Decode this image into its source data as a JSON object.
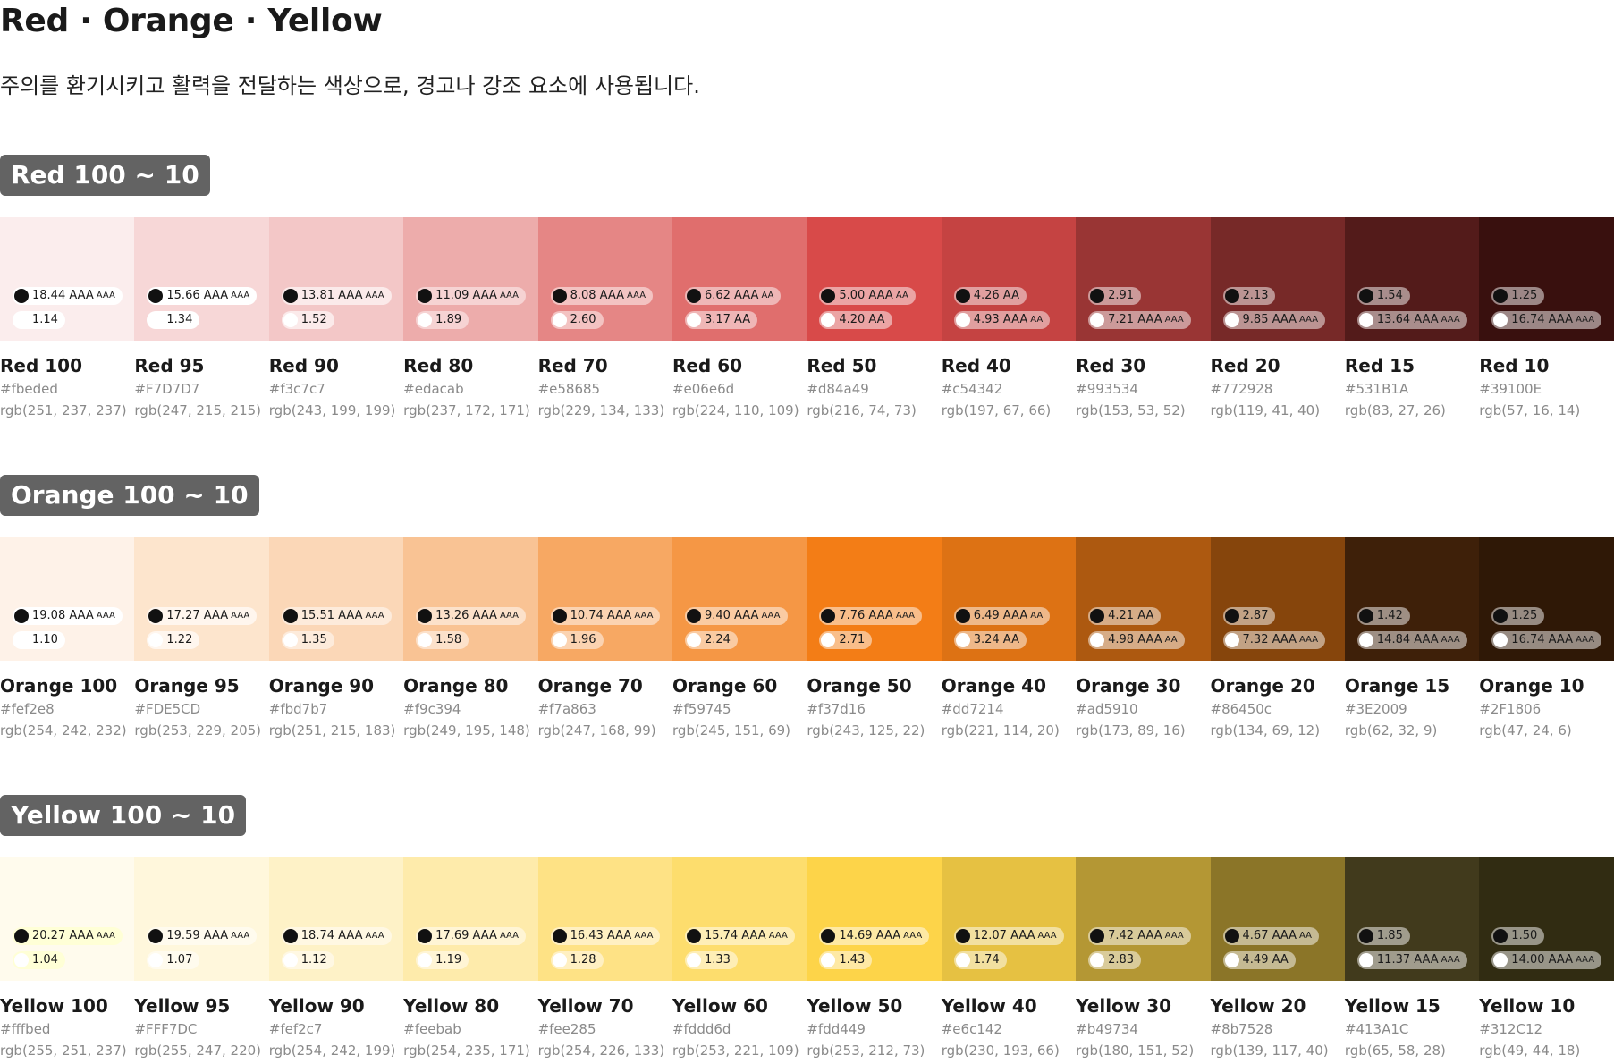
{
  "title": "Red · Orange · Yellow",
  "description": "주의를 환기시키고 활력을 전달하는 색상으로, 경고나 강조 요소에 사용됩니다.",
  "sections": [
    {
      "label": "Red 100 ~ 10",
      "swatches": [
        {
          "name": "Red 100",
          "hex": "#fbeded",
          "rgb": "rgb(251, 237, 237)",
          "black": "18.44 AAA",
          "black_level": "AAA",
          "white": "1.14",
          "white_level": "",
          "pill_dark_bg": "#ffffff",
          "pill_light_bg": "#ffffff",
          "pill_dark_fg": "#1a1a1a",
          "pill_light_fg": "#1a1a1a"
        },
        {
          "name": "Red 95",
          "hex": "#F7D7D7",
          "rgb": "rgb(247, 215, 215)",
          "black": "15.66 AAA",
          "black_level": "AAA",
          "white": "1.34",
          "white_level": "",
          "pill_dark_bg": "#ffffff",
          "pill_light_bg": "#ffffff",
          "pill_dark_fg": "#1a1a1a",
          "pill_light_fg": "#1a1a1a"
        },
        {
          "name": "Red 90",
          "hex": "#f3c7c7",
          "rgb": "rgb(243, 199, 199)",
          "black": "13.81 AAA",
          "black_level": "AAA",
          "white": "1.52",
          "white_level": "",
          "pill_dark_bg": "#fbeaea",
          "pill_light_bg": "#fbeaea",
          "pill_dark_fg": "#1a1a1a",
          "pill_light_fg": "#1a1a1a"
        },
        {
          "name": "Red 80",
          "hex": "#edacab",
          "rgb": "rgb(237, 172, 171)",
          "black": "11.09 AAA",
          "black_level": "AAA",
          "white": "1.89",
          "white_level": "",
          "pill_dark_bg": "#f6d3d3",
          "pill_light_bg": "#f6d3d3",
          "pill_dark_fg": "#1a1a1a",
          "pill_light_fg": "#1a1a1a"
        },
        {
          "name": "Red 70",
          "hex": "#e58685",
          "rgb": "rgb(229, 134, 133)",
          "black": "8.08 AAA",
          "black_level": "AAA",
          "white": "2.60",
          "white_level": "",
          "pill_dark_bg": "#f3c3c2",
          "pill_light_bg": "#f3c3c2",
          "pill_dark_fg": "#1a1a1a",
          "pill_light_fg": "#1a1a1a"
        },
        {
          "name": "Red 60",
          "hex": "#e06e6d",
          "rgb": "rgb(224, 110, 109)",
          "black": "6.62 AAA",
          "black_level": "AA",
          "white": "3.17 AA",
          "white_level": "",
          "pill_dark_bg": "#efb6b6",
          "pill_light_bg": "#efb6b6",
          "pill_dark_fg": "#1a1a1a",
          "pill_light_fg": "#1a1a1a"
        },
        {
          "name": "Red 50",
          "hex": "#d84a49",
          "rgb": "rgb(216, 74, 73)",
          "black": "5.00 AAA",
          "black_level": "AA",
          "white": "4.20 AA",
          "white_level": "",
          "pill_dark_bg": "#eba4a4",
          "pill_light_bg": "#eba4a4",
          "pill_dark_fg": "#1a1a1a",
          "pill_light_fg": "#1a1a1a"
        },
        {
          "name": "Red 40",
          "hex": "#c54342",
          "rgb": "rgb(197, 67, 66)",
          "black": "4.26 AA",
          "black_level": "",
          "white": "4.93 AAA",
          "white_level": "AA",
          "pill_dark_bg": "#e19f9f",
          "pill_light_bg": "#e19f9f",
          "pill_dark_fg": "#1a1a1a",
          "pill_light_fg": "#1a1a1a"
        },
        {
          "name": "Red 30",
          "hex": "#993534",
          "rgb": "rgb(153, 53, 52)",
          "black": "2.91",
          "black_level": "",
          "white": "7.21 AAA",
          "white_level": "AAA",
          "pill_dark_bg": "#cc9a9a",
          "pill_light_bg": "#cc9a9a",
          "pill_dark_fg": "#1a1a1a",
          "pill_light_fg": "#1a1a1a"
        },
        {
          "name": "Red 20",
          "hex": "#772928",
          "rgb": "rgb(119, 41, 40)",
          "black": "2.13",
          "black_level": "",
          "white": "9.85 AAA",
          "white_level": "AAA",
          "pill_dark_bg": "#bb9493",
          "pill_light_bg": "#bb9493",
          "pill_dark_fg": "#1a1a1a",
          "pill_light_fg": "#1a1a1a"
        },
        {
          "name": "Red 15",
          "hex": "#531B1A",
          "rgb": "rgb(83, 27, 26)",
          "black": "1.54",
          "black_level": "",
          "white": "13.64 AAA",
          "white_level": "AAA",
          "pill_dark_bg": "#a98d8c",
          "pill_light_bg": "#a98d8c",
          "pill_dark_fg": "#1a1a1a",
          "pill_light_fg": "#1a1a1a"
        },
        {
          "name": "Red 10",
          "hex": "#39100E",
          "rgb": "rgb(57, 16, 14)",
          "black": "1.25",
          "black_level": "",
          "white": "16.74 AAA",
          "white_level": "AAA",
          "pill_dark_bg": "#9c8786",
          "pill_light_bg": "#9c8786",
          "pill_dark_fg": "#1a1a1a",
          "pill_light_fg": "#1a1a1a"
        }
      ]
    },
    {
      "label": "Orange 100 ~ 10",
      "swatches": [
        {
          "name": "Orange 100",
          "hex": "#fef2e8",
          "rgb": "rgb(254, 242, 232)",
          "black": "19.08 AAA",
          "black_level": "AAA",
          "white": "1.10",
          "white_level": "",
          "pill_dark_bg": "#ffffff",
          "pill_light_bg": "#ffffff",
          "pill_dark_fg": "#1a1a1a",
          "pill_light_fg": "#1a1a1a"
        },
        {
          "name": "Orange 95",
          "hex": "#FDE5CD",
          "rgb": "rgb(253, 229, 205)",
          "black": "17.27 AAA",
          "black_level": "AAA",
          "white": "1.22",
          "white_level": "",
          "pill_dark_bg": "#fff6ee",
          "pill_light_bg": "#fff6ee",
          "pill_dark_fg": "#1a1a1a",
          "pill_light_fg": "#1a1a1a"
        },
        {
          "name": "Orange 90",
          "hex": "#fbd7b7",
          "rgb": "rgb(251, 215, 183)",
          "black": "15.51 AAA",
          "black_level": "AAA",
          "white": "1.35",
          "white_level": "",
          "pill_dark_bg": "#fdebdb",
          "pill_light_bg": "#fdebdb",
          "pill_dark_fg": "#1a1a1a",
          "pill_light_fg": "#1a1a1a"
        },
        {
          "name": "Orange 80",
          "hex": "#f9c394",
          "rgb": "rgb(249, 195, 148)",
          "black": "13.26 AAA",
          "black_level": "AAA",
          "white": "1.58",
          "white_level": "",
          "pill_dark_bg": "#fce1ca",
          "pill_light_bg": "#fce1ca",
          "pill_dark_fg": "#1a1a1a",
          "pill_light_fg": "#1a1a1a"
        },
        {
          "name": "Orange 70",
          "hex": "#f7a863",
          "rgb": "rgb(247, 168, 99)",
          "black": "10.74 AAA",
          "black_level": "AAA",
          "white": "1.96",
          "white_level": "",
          "pill_dark_bg": "#fbd3b1",
          "pill_light_bg": "#fbd3b1",
          "pill_dark_fg": "#1a1a1a",
          "pill_light_fg": "#1a1a1a"
        },
        {
          "name": "Orange 60",
          "hex": "#f59745",
          "rgb": "rgb(245, 151, 69)",
          "black": "9.40 AAA",
          "black_level": "AAA",
          "white": "2.24",
          "white_level": "",
          "pill_dark_bg": "#facba2",
          "pill_light_bg": "#facba2",
          "pill_dark_fg": "#1a1a1a",
          "pill_light_fg": "#1a1a1a"
        },
        {
          "name": "Orange 50",
          "hex": "#f37d16",
          "rgb": "rgb(243, 125, 22)",
          "black": "7.76 AAA",
          "black_level": "AAA",
          "white": "2.71",
          "white_level": "",
          "pill_dark_bg": "#f9be8a",
          "pill_light_bg": "#f9be8a",
          "pill_dark_fg": "#1a1a1a",
          "pill_light_fg": "#1a1a1a"
        },
        {
          "name": "Orange 40",
          "hex": "#dd7214",
          "rgb": "rgb(221, 114, 20)",
          "black": "6.49 AAA",
          "black_level": "AA",
          "white": "3.24 AA",
          "white_level": "",
          "pill_dark_bg": "#eeb889",
          "pill_light_bg": "#eeb889",
          "pill_dark_fg": "#1a1a1a",
          "pill_light_fg": "#1a1a1a"
        },
        {
          "name": "Orange 30",
          "hex": "#ad5910",
          "rgb": "rgb(173, 89, 16)",
          "black": "4.21 AA",
          "black_level": "",
          "white": "4.98 AAA",
          "white_level": "AA",
          "pill_dark_bg": "#d6ac87",
          "pill_light_bg": "#d6ac87",
          "pill_dark_fg": "#1a1a1a",
          "pill_light_fg": "#1a1a1a"
        },
        {
          "name": "Orange 20",
          "hex": "#86450c",
          "rgb": "rgb(134, 69, 12)",
          "black": "2.87",
          "black_level": "",
          "white": "7.32 AAA",
          "white_level": "AAA",
          "pill_dark_bg": "#c2a285",
          "pill_light_bg": "#c2a285",
          "pill_dark_fg": "#1a1a1a",
          "pill_light_fg": "#1a1a1a"
        },
        {
          "name": "Orange 15",
          "hex": "#3E2009",
          "rgb": "rgb(62, 32, 9)",
          "black": "1.42",
          "black_level": "",
          "white": "14.84 AAA",
          "white_level": "AAA",
          "pill_dark_bg": "#9e8f84",
          "pill_light_bg": "#9e8f84",
          "pill_dark_fg": "#1a1a1a",
          "pill_light_fg": "#1a1a1a"
        },
        {
          "name": "Orange 10",
          "hex": "#2F1806",
          "rgb": "rgb(47, 24, 6)",
          "black": "1.25",
          "black_level": "",
          "white": "16.74 AAA",
          "white_level": "AAA",
          "pill_dark_bg": "#978b82",
          "pill_light_bg": "#978b82",
          "pill_dark_fg": "#1a1a1a",
          "pill_light_fg": "#1a1a1a"
        }
      ]
    },
    {
      "label": "Yellow 100 ~ 10",
      "swatches": [
        {
          "name": "Yellow 100",
          "hex": "#fffbed",
          "rgb": "rgb(255, 251, 237)",
          "black": "20.27 AAA",
          "black_level": "AAA",
          "white": "1.04",
          "white_level": "",
          "pill_dark_bg": "#ffffd6",
          "pill_light_bg": "#ffffd6",
          "pill_dark_fg": "#1a1a1a",
          "pill_light_fg": "#1a1a1a"
        },
        {
          "name": "Yellow 95",
          "hex": "#FFF7DC",
          "rgb": "rgb(255, 247, 220)",
          "black": "19.59 AAA",
          "black_level": "AAA",
          "white": "1.07",
          "white_level": "",
          "pill_dark_bg": "#fffbee",
          "pill_light_bg": "#fffbee",
          "pill_dark_fg": "#1a1a1a",
          "pill_light_fg": "#1a1a1a"
        },
        {
          "name": "Yellow 90",
          "hex": "#fef2c7",
          "rgb": "rgb(254, 242, 199)",
          "black": "18.74 AAA",
          "black_level": "AAA",
          "white": "1.12",
          "white_level": "",
          "pill_dark_bg": "#fff8e3",
          "pill_light_bg": "#fff8e3",
          "pill_dark_fg": "#1a1a1a",
          "pill_light_fg": "#1a1a1a"
        },
        {
          "name": "Yellow 80",
          "hex": "#feebab",
          "rgb": "rgb(254, 235, 171)",
          "black": "17.69 AAA",
          "black_level": "AAA",
          "white": "1.19",
          "white_level": "",
          "pill_dark_bg": "#fff5d5",
          "pill_light_bg": "#fff5d5",
          "pill_dark_fg": "#1a1a1a",
          "pill_light_fg": "#1a1a1a"
        },
        {
          "name": "Yellow 70",
          "hex": "#fee285",
          "rgb": "rgb(254, 226, 133)",
          "black": "16.43 AAA",
          "black_level": "AAA",
          "white": "1.28",
          "white_level": "",
          "pill_dark_bg": "#fff0c2",
          "pill_light_bg": "#fff0c2",
          "pill_dark_fg": "#1a1a1a",
          "pill_light_fg": "#1a1a1a"
        },
        {
          "name": "Yellow 60",
          "hex": "#fddd6d",
          "rgb": "rgb(253, 221, 109)",
          "black": "15.74 AAA",
          "black_level": "AAA",
          "white": "1.33",
          "white_level": "",
          "pill_dark_bg": "#feeeb6",
          "pill_light_bg": "#feeeb6",
          "pill_dark_fg": "#1a1a1a",
          "pill_light_fg": "#1a1a1a"
        },
        {
          "name": "Yellow 50",
          "hex": "#fdd449",
          "rgb": "rgb(253, 212, 73)",
          "black": "14.69 AAA",
          "black_level": "AAA",
          "white": "1.43",
          "white_level": "",
          "pill_dark_bg": "#fee9a4",
          "pill_light_bg": "#fee9a4",
          "pill_dark_fg": "#1a1a1a",
          "pill_light_fg": "#1a1a1a"
        },
        {
          "name": "Yellow 40",
          "hex": "#e6c142",
          "rgb": "rgb(230, 193, 66)",
          "black": "12.07 AAA",
          "black_level": "AAA",
          "white": "1.74",
          "white_level": "",
          "pill_dark_bg": "#f2e0a0",
          "pill_light_bg": "#f2e0a0",
          "pill_dark_fg": "#1a1a1a",
          "pill_light_fg": "#1a1a1a"
        },
        {
          "name": "Yellow 30",
          "hex": "#b49734",
          "rgb": "rgb(180, 151, 52)",
          "black": "7.42 AAA",
          "black_level": "AAA",
          "white": "2.83",
          "white_level": "",
          "pill_dark_bg": "#d9cb9a",
          "pill_light_bg": "#d9cb9a",
          "pill_dark_fg": "#1a1a1a",
          "pill_light_fg": "#1a1a1a"
        },
        {
          "name": "Yellow 20",
          "hex": "#8b7528",
          "rgb": "rgb(139, 117, 40)",
          "black": "4.67 AAA",
          "black_level": "AA",
          "white": "4.49 AA",
          "white_level": "",
          "pill_dark_bg": "#c5ba93",
          "pill_light_bg": "#c5ba93",
          "pill_dark_fg": "#1a1a1a",
          "pill_light_fg": "#1a1a1a"
        },
        {
          "name": "Yellow 15",
          "hex": "#413A1C",
          "rgb": "rgb(65, 58, 28)",
          "black": "1.85",
          "black_level": "",
          "white": "11.37 AAA",
          "white_level": "AAA",
          "pill_dark_bg": "#a09c8d",
          "pill_light_bg": "#a09c8d",
          "pill_dark_fg": "#1a1a1a",
          "pill_light_fg": "#1a1a1a"
        },
        {
          "name": "Yellow 10",
          "hex": "#312C12",
          "rgb": "rgb(49, 44, 18)",
          "black": "1.50",
          "black_level": "",
          "white": "14.00 AAA",
          "white_level": "AAA",
          "pill_dark_bg": "#989588",
          "pill_light_bg": "#989588",
          "pill_dark_fg": "#1a1a1a",
          "pill_light_fg": "#1a1a1a"
        }
      ]
    }
  ]
}
